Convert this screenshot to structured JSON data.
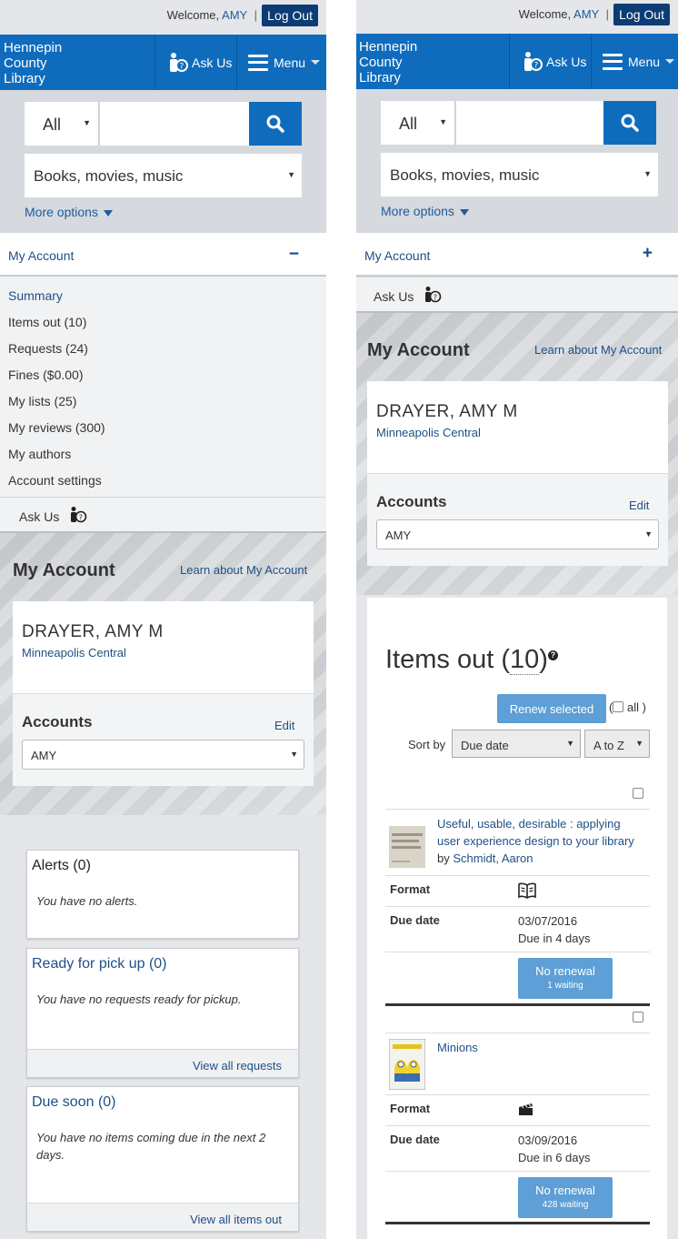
{
  "topbar": {
    "welcome": "Welcome,",
    "user": "AMY",
    "separator": "|",
    "logout": "Log Out"
  },
  "header": {
    "logo_line1": "Hennepin",
    "logo_line2": "County",
    "logo_line3": "Library",
    "ask_us": "Ask Us",
    "menu": "Menu"
  },
  "search": {
    "scope": "All",
    "category": "Books, movies, music",
    "more_options": "More options",
    "query": ""
  },
  "account_bar": {
    "label": "My Account",
    "toggle_open": "−",
    "toggle_closed": "+"
  },
  "nav": [
    "Summary",
    "Items out (10)",
    "Requests (24)",
    "Fines ($0.00)",
    "My lists (25)",
    "My reviews (300)",
    "My authors",
    "Account settings"
  ],
  "ask_row": "Ask Us",
  "account": {
    "heading": "My Account",
    "learn": "Learn about My Account",
    "patron_name": "DRAYER, AMY M",
    "branch": "Minneapolis Central",
    "accounts_title": "Accounts",
    "edit": "Edit",
    "selected_account": "AMY"
  },
  "panels": {
    "alerts": {
      "title": "Alerts (0)",
      "body": "You have no alerts."
    },
    "pickup": {
      "title": "Ready for pick up (0)",
      "body": "You have no requests ready for pickup.",
      "footer": "View all requests"
    },
    "due": {
      "title": "Due soon (0)",
      "body": "You have no items coming due in the next 2 days.",
      "footer": "View all items out"
    }
  },
  "items_out": {
    "title_prefix": "Items out (",
    "count": "10",
    "title_suffix": ")",
    "help": "?",
    "renew_selected": "Renew selected",
    "all_label": "all )",
    "open_paren": "(",
    "sort_by": "Sort by",
    "sort_field": "Due date",
    "sort_order": "A to Z",
    "format_label": "Format",
    "due_label": "Due date",
    "items": [
      {
        "title": "Useful, usable, desirable : applying user experience design to your library",
        "by": "by",
        "author": "Schmidt, Aaron",
        "format_icon": "book-icon",
        "due_date": "03/07/2016",
        "due_in": "Due in 4 days",
        "renew_label": "No renewal",
        "waiting": "1 waiting"
      },
      {
        "title": "Minions",
        "format_icon": "movie-icon",
        "due_date": "03/09/2016",
        "due_in": "Due in 6 days",
        "renew_label": "No renewal",
        "waiting": "428 waiting"
      }
    ]
  },
  "colors": {
    "brand_blue": "#0f6cbd",
    "dark_blue": "#0c3c74",
    "link": "#1f4f86",
    "button_light": "#5d9fd6"
  }
}
